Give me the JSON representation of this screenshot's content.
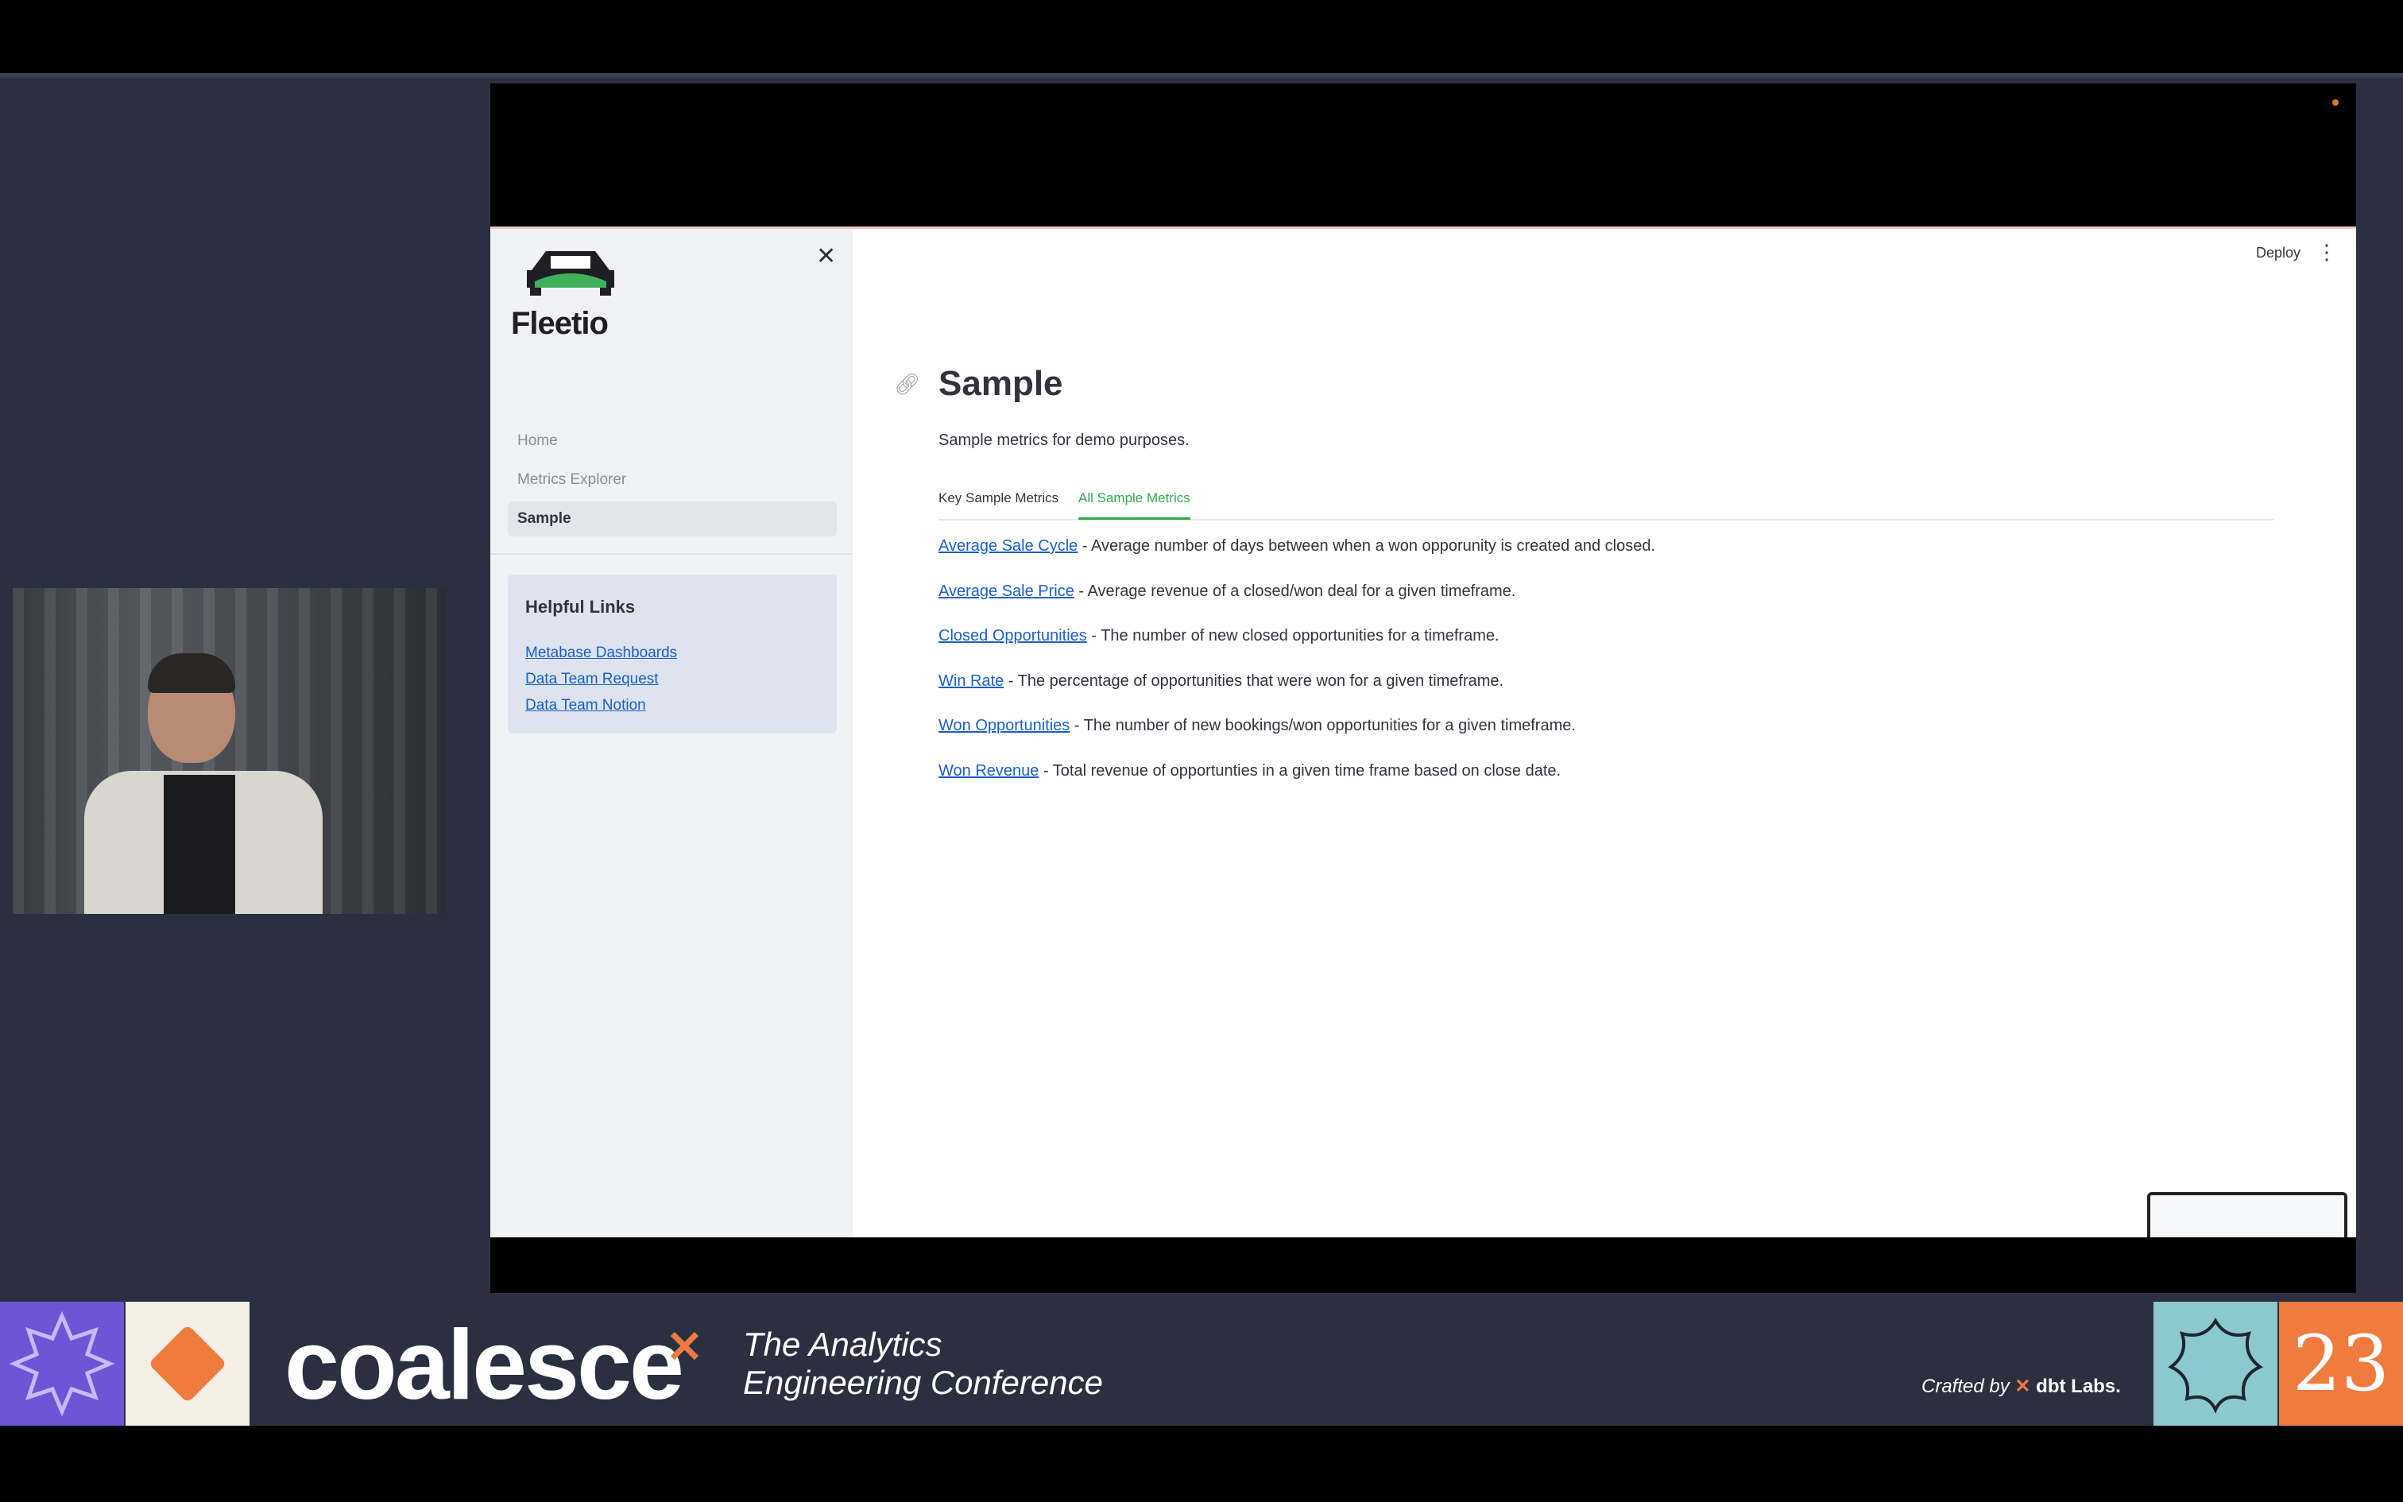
{
  "app": {
    "logo_text": "Fleetio",
    "toolbar": {
      "deploy_label": "Deploy"
    },
    "sidebar": {
      "nav_items": [
        {
          "label": "Home",
          "active": false
        },
        {
          "label": "Metrics Explorer",
          "active": false
        },
        {
          "label": "Sample",
          "active": true
        }
      ],
      "helpful_links": {
        "title": "Helpful Links",
        "links": [
          "Metabase Dashboards",
          "Data Team Request",
          "Data Team Notion"
        ]
      }
    },
    "page": {
      "title": "Sample",
      "subtitle": "Sample metrics for demo purposes.",
      "tabs": [
        {
          "label": "Key Sample Metrics",
          "active": false
        },
        {
          "label": "All Sample Metrics",
          "active": true
        }
      ],
      "metrics": [
        {
          "name": "Average Sale Cycle",
          "description": " - Average number of days between when a won opporunity is created and closed."
        },
        {
          "name": "Average Sale Price",
          "description": " - Average revenue of a closed/won deal for a given timeframe."
        },
        {
          "name": "Closed Opportunities",
          "description": " - The number of new closed opportunities for a timeframe."
        },
        {
          "name": "Win Rate",
          "description": " - The percentage of opportunities that were won for a given timeframe."
        },
        {
          "name": "Won Opportunities",
          "description": " - The number of new bookings/won opportunities for a given timeframe."
        },
        {
          "name": "Won Revenue",
          "description": " - Total revenue of opportunties in a given time frame based on close date."
        }
      ]
    }
  },
  "banner": {
    "brand": "coalesce",
    "tagline_line1": "The Analytics",
    "tagline_line2": "Engineering Conference",
    "crafted_by": "Crafted by",
    "crafted_brand": "dbt Labs.",
    "year": "23"
  },
  "colors": {
    "accent_green": "#2fa84f",
    "link_blue": "#1b5fc8",
    "banner_orange": "#ef7b3f",
    "banner_purple": "#6e55d6"
  }
}
